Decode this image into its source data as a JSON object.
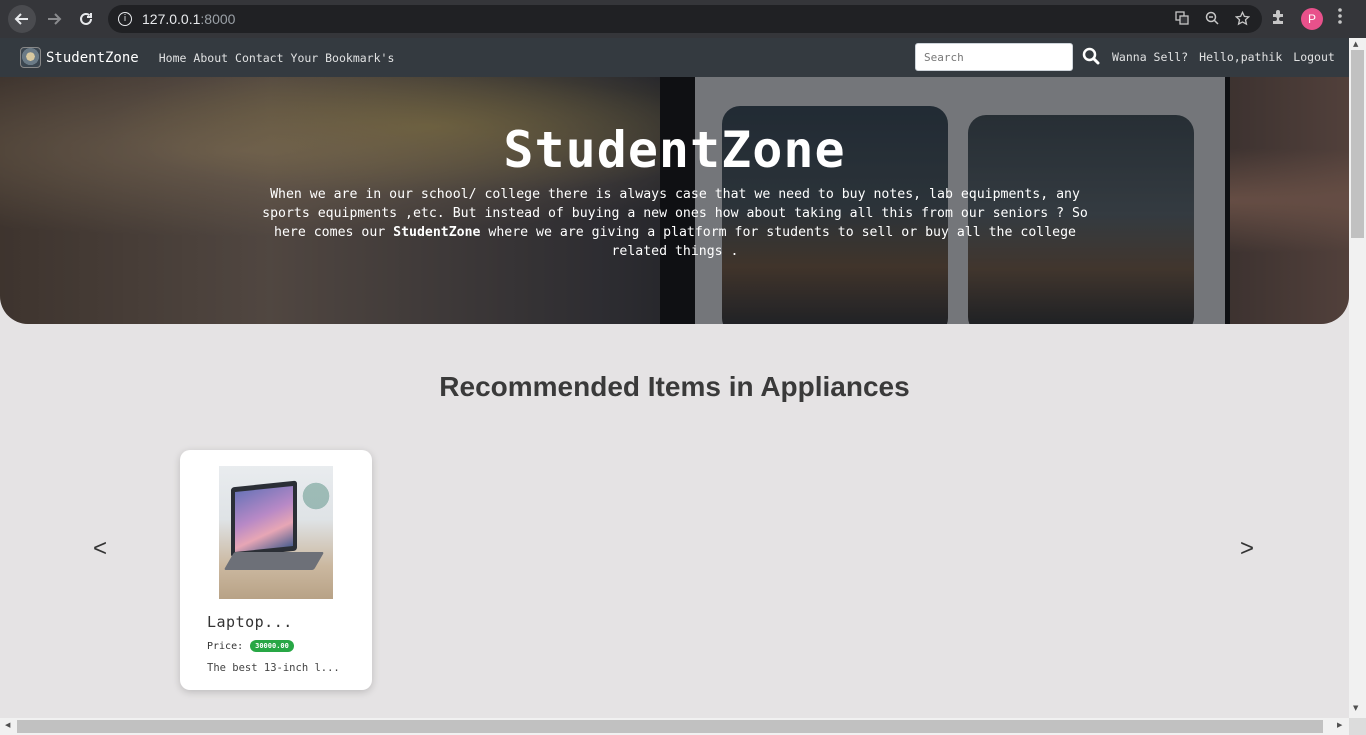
{
  "browser": {
    "url_host": "127.0.0.1",
    "url_port": ":8000",
    "profile_initial": "P",
    "icons": [
      "back-arrow-icon",
      "forward-arrow-icon",
      "reload-icon",
      "info-icon",
      "translate-icon",
      "zoom-icon",
      "star-icon",
      "extensions-icon",
      "menu-dots-icon"
    ]
  },
  "navbar": {
    "brand": "StudentZone",
    "links": [
      "Home",
      "About",
      "Contact",
      "Your Bookmark's"
    ],
    "search_placeholder": "Search",
    "right_links": [
      "Wanna Sell?",
      "Hello,pathik",
      "Logout"
    ],
    "bg_color": "#343a40"
  },
  "hero": {
    "title": "StudentZone",
    "desc_part1": "When we are in our school/ college there is always case that we need to buy notes, lab equipments, any sports equipments ,etc. But instead of buying a new ones how about taking all this from our seniors ? So here comes our ",
    "desc_bold": "StudentZone",
    "desc_part2": " where we are giving a platform for students to sell or buy all the college related things ."
  },
  "section": {
    "title": "Recommended Items in Appliances",
    "prev_label": "<",
    "next_label": ">"
  },
  "items": [
    {
      "title": "Laptop...",
      "price_label": "Price:",
      "price": "30000.00",
      "description": "The best 13-inch l...",
      "price_badge_color": "#28a745"
    }
  ]
}
